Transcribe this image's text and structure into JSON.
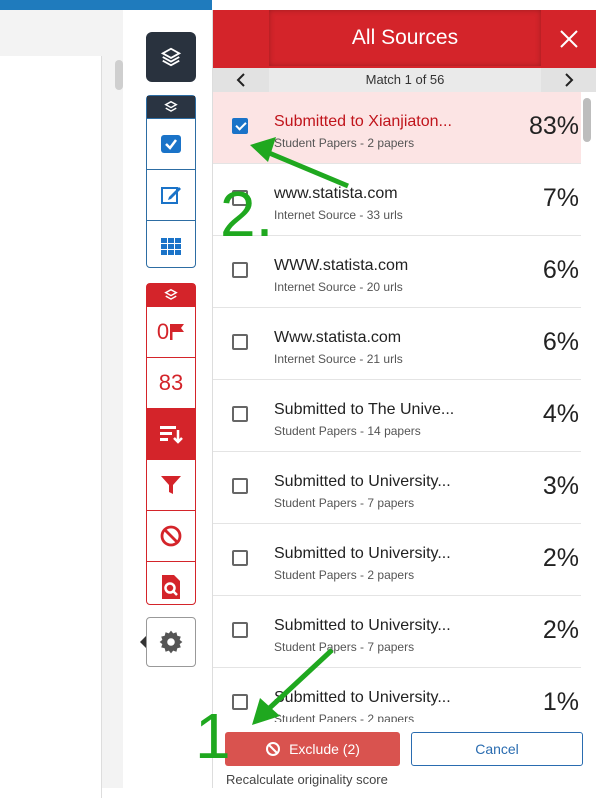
{
  "panel": {
    "title": "All Sources",
    "match_text": "Match 1 of 56"
  },
  "rail": {
    "flag_count": "0",
    "similarity_count": "83"
  },
  "sources": [
    {
      "title": "Submitted to Xianjiaton...",
      "subtitle": "Student Papers - 2 papers",
      "percent": "83%",
      "checked": true
    },
    {
      "title": "www.statista.com",
      "subtitle": "Internet Source - 33 urls",
      "percent": "7%",
      "checked": false
    },
    {
      "title": "WWW.statista.com",
      "subtitle": "Internet Source - 20 urls",
      "percent": "6%",
      "checked": false
    },
    {
      "title": "Www.statista.com",
      "subtitle": "Internet Source - 21 urls",
      "percent": "6%",
      "checked": false
    },
    {
      "title": "Submitted to The Unive...",
      "subtitle": "Student Papers - 14 papers",
      "percent": "4%",
      "checked": false
    },
    {
      "title": "Submitted to University...",
      "subtitle": "Student Papers - 7 papers",
      "percent": "3%",
      "checked": false
    },
    {
      "title": "Submitted to University...",
      "subtitle": "Student Papers - 2 papers",
      "percent": "2%",
      "checked": false
    },
    {
      "title": "Submitted to University...",
      "subtitle": "Student Papers - 7 papers",
      "percent": "2%",
      "checked": false
    },
    {
      "title": "Submitted to University...",
      "subtitle": "Student Papers - 2 papers",
      "percent": "1%",
      "checked": false
    }
  ],
  "footer": {
    "exclude_label": "Exclude (2)",
    "cancel_label": "Cancel",
    "recalc_label": "Recalculate originality score"
  },
  "annotations": {
    "step1": "1",
    "step2": "2."
  },
  "colors": {
    "accent_red": "#d4242a",
    "annotation_green": "#1fa81f",
    "checkbox_blue": "#1a73c8"
  }
}
